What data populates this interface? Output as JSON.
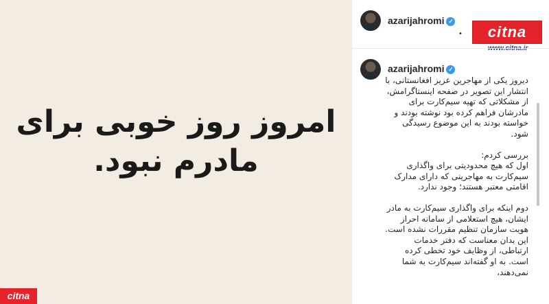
{
  "post_image": {
    "line1": "امروز روز خوبی برای",
    "line2": "مادرم نبود."
  },
  "header": {
    "username": "azarijahromi",
    "verified": true,
    "more_menu": "•"
  },
  "watermark": {
    "logo_text": "citna",
    "url": "www.citna.ir",
    "color": "#e5232a"
  },
  "caption": {
    "username": "azarijahromi",
    "paragraphs": [
      "دیروز یکی از مهاجرین عزیز افغانستانی، با انتشار این تصویر در صفحه اینستاگرامش، از مشکلاتی که تهیه سیم‌کارت برای مادرشان فراهم کرده بود نوشته بودند و خواسته بودند به این موضوع رسیدگی شود.",
      "بررسی کردم:",
      "اول که هیچ محدودیتی برای واگذاری سیم‌کارت به مهاجرینی که دارای مدارک اقامتی معتبر هستند؛ وجود ندارد.",
      "دوم اینکه برای واگذاری سیم‌کارت به مادر ایشان، هیچ استعلامی از سامانه احراز هویت سازمان تنظیم مقررات نشده است.",
      "این بدان معناست که دفتر خدمات ارتباطی، از وظایف خود تخطی کرده است. به او گفته‌اند سیم‌کارت به شما نمی‌دهند،"
    ]
  },
  "colors": {
    "post_background": "#f3ece2",
    "verified_badge": "#3897f0",
    "text": "#262626"
  }
}
